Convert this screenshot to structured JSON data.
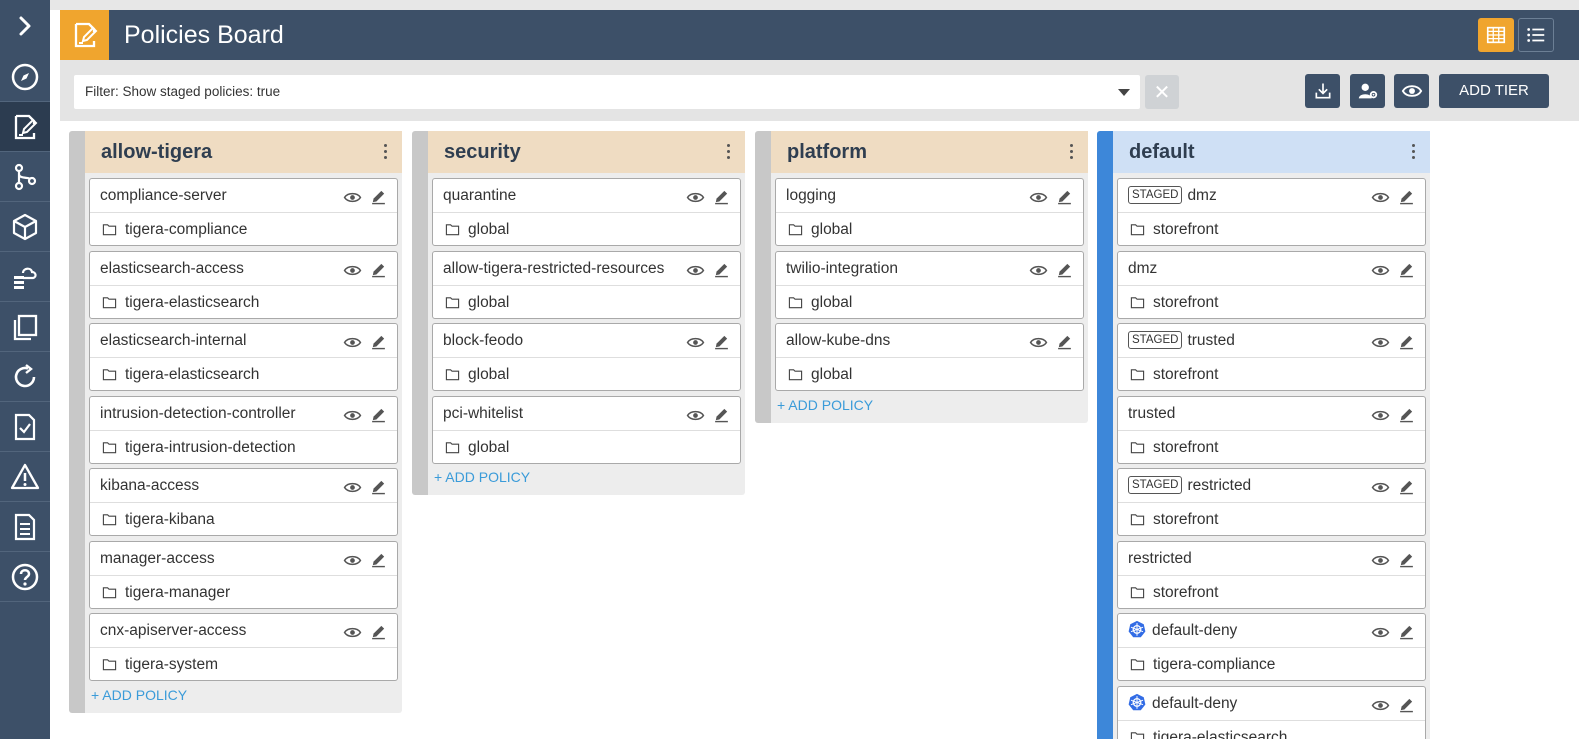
{
  "sidebar": {
    "items": [
      {
        "name": "expand-icon"
      },
      {
        "name": "compass-icon"
      },
      {
        "name": "policy-board-icon"
      },
      {
        "name": "git-branch-icon"
      },
      {
        "name": "cube-icon"
      },
      {
        "name": "cloud-stack-icon"
      },
      {
        "name": "copy-icon"
      },
      {
        "name": "refresh-icon"
      },
      {
        "name": "compliance-icon"
      },
      {
        "name": "alert-icon"
      },
      {
        "name": "report-icon"
      },
      {
        "name": "help-icon"
      }
    ]
  },
  "header": {
    "title": "Policies Board"
  },
  "filter": {
    "text": "Filter: Show staged policies: true",
    "clear": "✕"
  },
  "actions": {
    "add_tier": "ADD TIER"
  },
  "tiers": [
    {
      "name": "allow-tigera",
      "add_policy": "+ ADD POLICY",
      "policies": [
        {
          "name": "compliance-server",
          "namespace": "tigera-compliance"
        },
        {
          "name": "elasticsearch-access",
          "namespace": "tigera-elasticsearch"
        },
        {
          "name": "elasticsearch-internal",
          "namespace": "tigera-elasticsearch"
        },
        {
          "name": "intrusion-detection-controller",
          "namespace": "tigera-intrusion-detection"
        },
        {
          "name": "kibana-access",
          "namespace": "tigera-kibana"
        },
        {
          "name": "manager-access",
          "namespace": "tigera-manager"
        },
        {
          "name": "cnx-apiserver-access",
          "namespace": "tigera-system"
        }
      ]
    },
    {
      "name": "security",
      "add_policy": "+ ADD POLICY",
      "policies": [
        {
          "name": "quarantine",
          "namespace": "global"
        },
        {
          "name": "allow-tigera-restricted-resources",
          "namespace": "global"
        },
        {
          "name": "block-feodo",
          "namespace": "global"
        },
        {
          "name": "pci-whitelist",
          "namespace": "global"
        }
      ]
    },
    {
      "name": "platform",
      "add_policy": "+ ADD POLICY",
      "policies": [
        {
          "name": "logging",
          "namespace": "global"
        },
        {
          "name": "twilio-integration",
          "namespace": "global"
        },
        {
          "name": "allow-kube-dns",
          "namespace": "global"
        }
      ]
    },
    {
      "name": "default",
      "staged_label": "STAGED",
      "policies": [
        {
          "name": "dmz",
          "namespace": "storefront",
          "staged": true
        },
        {
          "name": "dmz",
          "namespace": "storefront"
        },
        {
          "name": "trusted",
          "namespace": "storefront",
          "staged": true
        },
        {
          "name": "trusted",
          "namespace": "storefront"
        },
        {
          "name": "restricted",
          "namespace": "storefront",
          "staged": true
        },
        {
          "name": "restricted",
          "namespace": "storefront"
        },
        {
          "name": "default-deny",
          "namespace": "tigera-compliance",
          "k8s": true
        },
        {
          "name": "default-deny",
          "namespace": "tigera-elasticsearch",
          "k8s": true
        }
      ]
    }
  ],
  "colors": {
    "nav": "#3d5068",
    "accent": "#f0a52e",
    "tier_header": "#efdcc2",
    "default_tier_header": "#cfe0f5",
    "default_tier_bar": "#3d87d9",
    "link": "#3a9bd9"
  }
}
